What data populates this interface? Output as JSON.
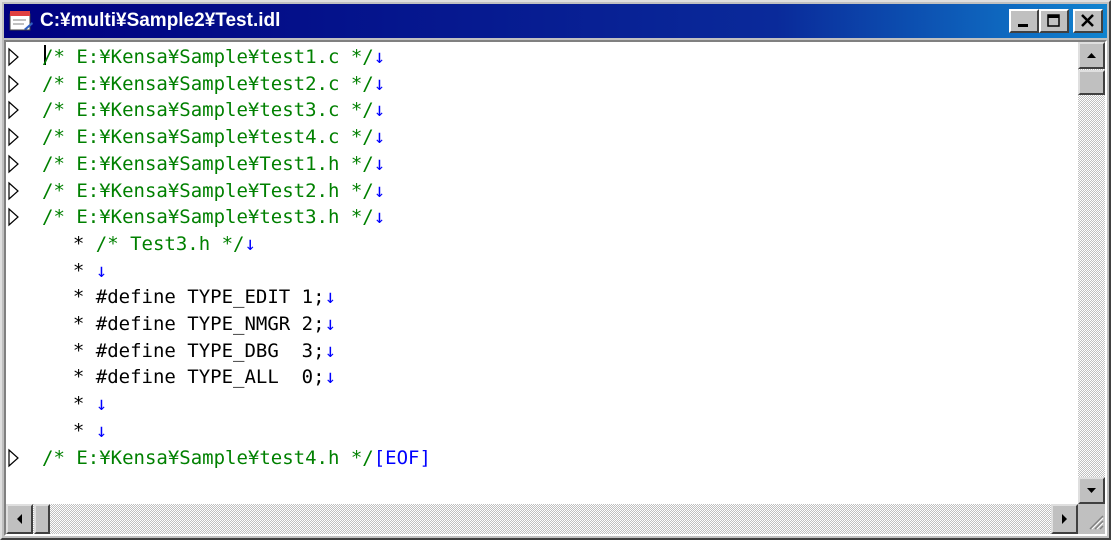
{
  "window": {
    "title": "C:¥multi¥Sample2¥Test.idl"
  },
  "controls": {
    "minimize": "minimize",
    "maximize": "maximize",
    "close": "close"
  },
  "editor": {
    "lines": [
      {
        "marker": true,
        "indent": "",
        "star": "",
        "comment": "/* E:¥Kensa¥Sample¥test1.c */",
        "code": "",
        "end": "eol"
      },
      {
        "marker": true,
        "indent": "",
        "star": "",
        "comment": "/* E:¥Kensa¥Sample¥test2.c */",
        "code": "",
        "end": "eol"
      },
      {
        "marker": true,
        "indent": "",
        "star": "",
        "comment": "/* E:¥Kensa¥Sample¥test3.c */",
        "code": "",
        "end": "eol"
      },
      {
        "marker": true,
        "indent": "",
        "star": "",
        "comment": "/* E:¥Kensa¥Sample¥test4.c */",
        "code": "",
        "end": "eol"
      },
      {
        "marker": true,
        "indent": "",
        "star": "",
        "comment": "/* E:¥Kensa¥Sample¥Test1.h */",
        "code": "",
        "end": "eol"
      },
      {
        "marker": true,
        "indent": "",
        "star": "",
        "comment": "/* E:¥Kensa¥Sample¥Test2.h */",
        "code": "",
        "end": "eol"
      },
      {
        "marker": true,
        "indent": "",
        "star": "",
        "comment": "/* E:¥Kensa¥Sample¥test3.h */",
        "code": "",
        "end": "eol"
      },
      {
        "marker": false,
        "indent": "  ",
        "star": "* ",
        "comment": "/* Test3.h */",
        "code": "",
        "end": "eol"
      },
      {
        "marker": false,
        "indent": "  ",
        "star": "* ",
        "comment": "",
        "code": "",
        "end": "eol"
      },
      {
        "marker": false,
        "indent": "  ",
        "star": "* ",
        "comment": "",
        "code": "#define TYPE_EDIT 1;",
        "end": "eol"
      },
      {
        "marker": false,
        "indent": "  ",
        "star": "* ",
        "comment": "",
        "code": "#define TYPE_NMGR 2;",
        "end": "eol"
      },
      {
        "marker": false,
        "indent": "  ",
        "star": "* ",
        "comment": "",
        "code": "#define TYPE_DBG  3;",
        "end": "eol"
      },
      {
        "marker": false,
        "indent": "  ",
        "star": "* ",
        "comment": "",
        "code": "#define TYPE_ALL  0;",
        "end": "eol"
      },
      {
        "marker": false,
        "indent": "  ",
        "star": "* ",
        "comment": "",
        "code": "",
        "end": "eol"
      },
      {
        "marker": false,
        "indent": "  ",
        "star": "* ",
        "comment": "",
        "code": "",
        "end": "eol"
      },
      {
        "marker": true,
        "indent": "",
        "star": "",
        "comment": "/* E:¥Kensa¥Sample¥test4.h */",
        "code": "",
        "end": "eof"
      }
    ],
    "eol_symbol": "↓",
    "eof_text": "[EOF]"
  },
  "colors": {
    "comment": "#008000",
    "eol": "#0000ff",
    "title_bar": "#000080"
  }
}
